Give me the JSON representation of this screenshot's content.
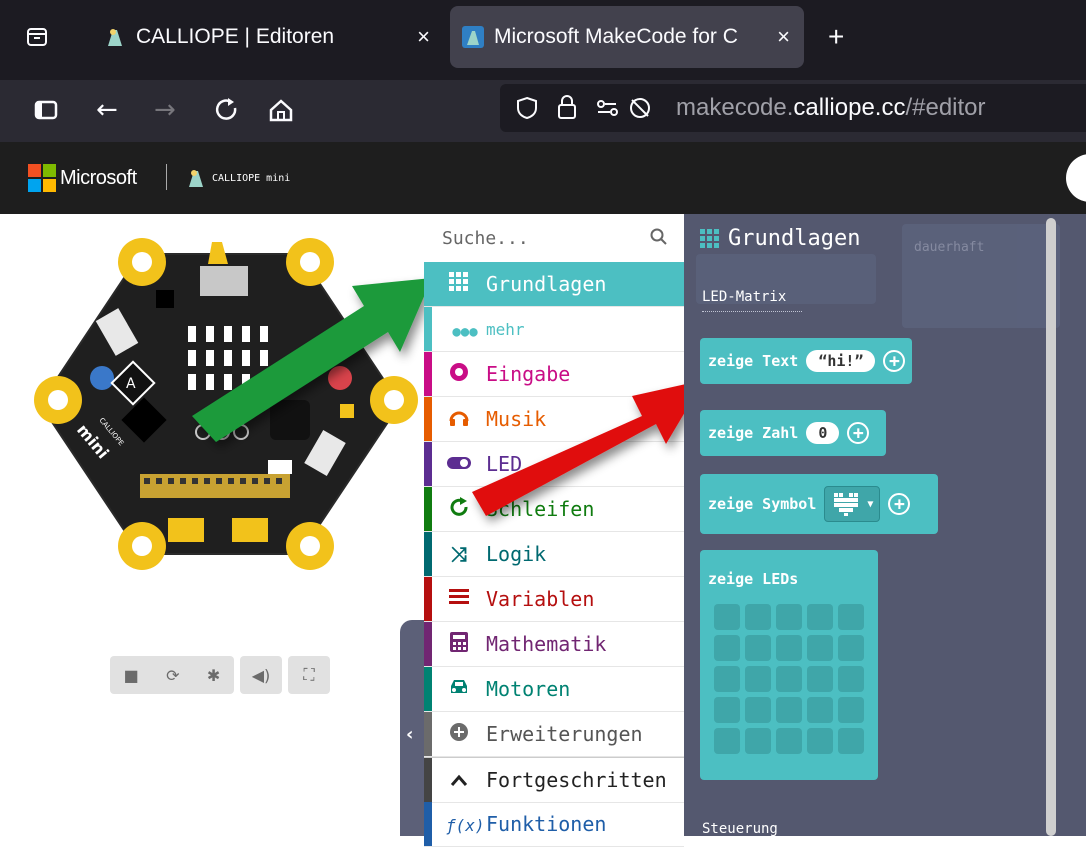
{
  "browser": {
    "tabs": [
      {
        "label": "CALLIOPE | Editoren",
        "close": "×"
      },
      {
        "label": "Microsoft MakeCode for C",
        "close": "×"
      }
    ],
    "new_tab": "+",
    "url_prefix": "makecode.",
    "url_domain": "calliope.cc",
    "url_path": "/#editor"
  },
  "makecode_bar": {
    "microsoft_label": "Microsoft",
    "calliope_label": "CALLIOPE mini"
  },
  "simulator": {
    "button_a": "A",
    "brand": "CALLIOPE",
    "model": "mini"
  },
  "toolbox": {
    "search_placeholder": "Suche...",
    "categories": [
      {
        "label": "Grundlagen",
        "color": "#4cbfc2",
        "icon": "grid-icon"
      },
      {
        "label": "mehr",
        "color": "#4cbfc2",
        "icon": "dots-icon"
      },
      {
        "label": "Eingabe",
        "color": "#c90d86",
        "icon": "circle-icon"
      },
      {
        "label": "Musik",
        "color": "#e65c00",
        "icon": "headphones-icon"
      },
      {
        "label": "LED",
        "color": "#5c2d91",
        "icon": "toggle-icon"
      },
      {
        "label": "Schleifen",
        "color": "#107c10",
        "icon": "loop-icon"
      },
      {
        "label": "Logik",
        "color": "#006970",
        "icon": "shuffle-icon"
      },
      {
        "label": "Variablen",
        "color": "#b50f0f",
        "icon": "list-icon"
      },
      {
        "label": "Mathematik",
        "color": "#712672",
        "icon": "calculator-icon"
      },
      {
        "label": "Motoren",
        "color": "#008272",
        "icon": "car-icon"
      },
      {
        "label": "Erweiterungen",
        "color": "#6b6b6b",
        "icon": "plus-circle-icon"
      },
      {
        "label": "Fortgeschritten",
        "color": "#3a3a3a",
        "icon": "chevron-up-icon"
      },
      {
        "label": "Funktionen",
        "color": "#1f5ea8",
        "icon": "function-icon"
      }
    ]
  },
  "flyout": {
    "title": "Grundlagen",
    "section_led": "LED-Matrix",
    "blocks": {
      "show_text": "zeige Text",
      "show_text_value": "hi!",
      "show_number": "zeige Zahl",
      "show_number_value": "0",
      "show_icon": "zeige Symbol",
      "show_leds": "zeige LEDs"
    },
    "section_control": "Steuerung",
    "ghost_block": "dauerhaft"
  },
  "colors": {
    "arrow_green": "#1a9a3a",
    "arrow_red": "#e01010",
    "block_teal": "#4cbfc2"
  }
}
